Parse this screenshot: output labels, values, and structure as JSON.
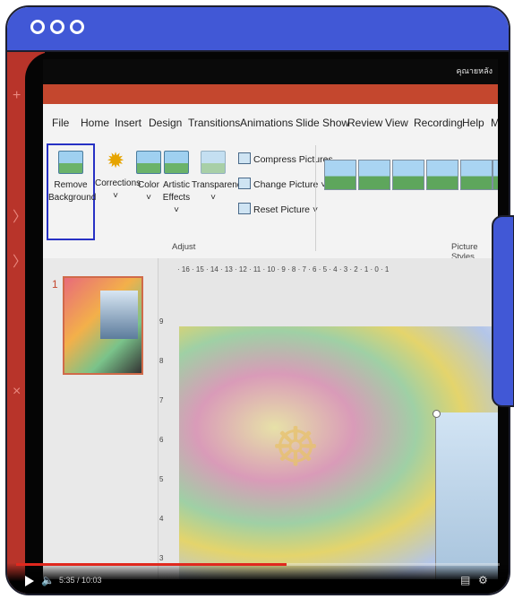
{
  "window": {
    "accent": "#4158d6"
  },
  "video": {
    "ppt_owner": "คุณายหลัง",
    "menu": [
      "File",
      "Home",
      "Insert",
      "Design",
      "Transitions",
      "Animations",
      "Slide Show",
      "Review",
      "View",
      "Recording",
      "Help",
      "M"
    ],
    "ribbon": {
      "remove_bg_1": "Remove",
      "remove_bg_2": "Background",
      "corrections": "Corrections",
      "corrections_arrow": "˅",
      "color": "Color",
      "color_arrow": "˅",
      "artistic_1": "Artistic",
      "artistic_2": "Effects ˅",
      "transparency": "Transparency",
      "transparency_arrow": "˅",
      "compress": "Compress Pictures",
      "change": "Change Picture ˅",
      "reset": "Reset Picture ˅",
      "adjust_label": "Adjust",
      "picture_styles_label": "Picture Styles"
    },
    "slide_number": "1",
    "ruler_h": "· 16 · 15 · 14 · 13 · 12 · 11 · 10 · 9 · 8 · 7 · 6 · 5 · 4 · 3 · 2 · 1 · 0 · 1",
    "ruler_v": [
      "9",
      "8",
      "7",
      "6",
      "5",
      "4",
      "3"
    ],
    "time": "5:35 / 10:03",
    "progress_fraction": 0.56
  }
}
